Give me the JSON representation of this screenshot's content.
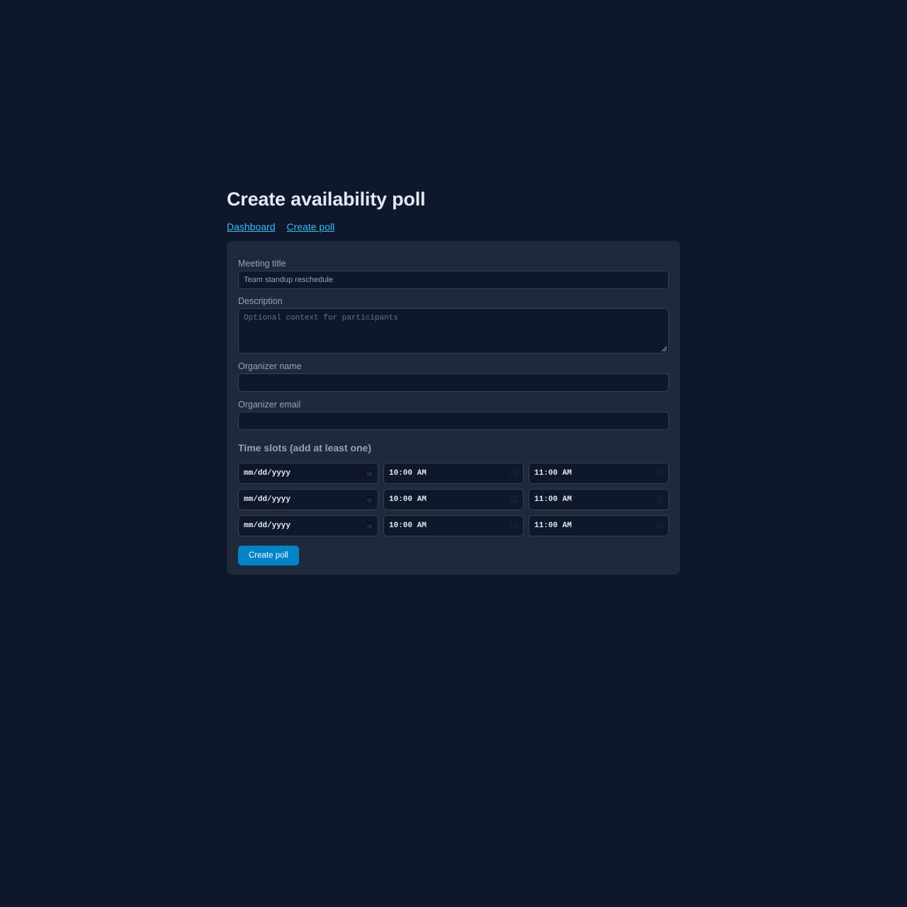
{
  "page": {
    "title": "Create availability poll"
  },
  "nav": {
    "items": [
      {
        "label": "Dashboard"
      },
      {
        "label": "Create poll"
      }
    ]
  },
  "form": {
    "meeting_title": {
      "label": "Meeting title",
      "placeholder": "Team standup reschedule",
      "value": ""
    },
    "description": {
      "label": "Description",
      "placeholder": "Optional context for participants",
      "value": ""
    },
    "organizer_name": {
      "label": "Organizer name",
      "value": ""
    },
    "organizer_email": {
      "label": "Organizer email",
      "value": ""
    },
    "time_slots": {
      "heading": "Time slots (add at least one)",
      "rows": [
        {
          "date": "mm/dd/yyyy",
          "start": "10:00 AM",
          "end": "11:00 AM"
        },
        {
          "date": "mm/dd/yyyy",
          "start": "10:00 AM",
          "end": "11:00 AM"
        },
        {
          "date": "mm/dd/yyyy",
          "start": "10:00 AM",
          "end": "11:00 AM"
        }
      ]
    },
    "submit_label": "Create poll"
  },
  "icons": {
    "date": "calendar-icon",
    "time": "clock-icon"
  },
  "colors": {
    "background": "#0f172a",
    "card": "#1e293b",
    "accent": "#0284c7",
    "link": "#38bdf8"
  }
}
